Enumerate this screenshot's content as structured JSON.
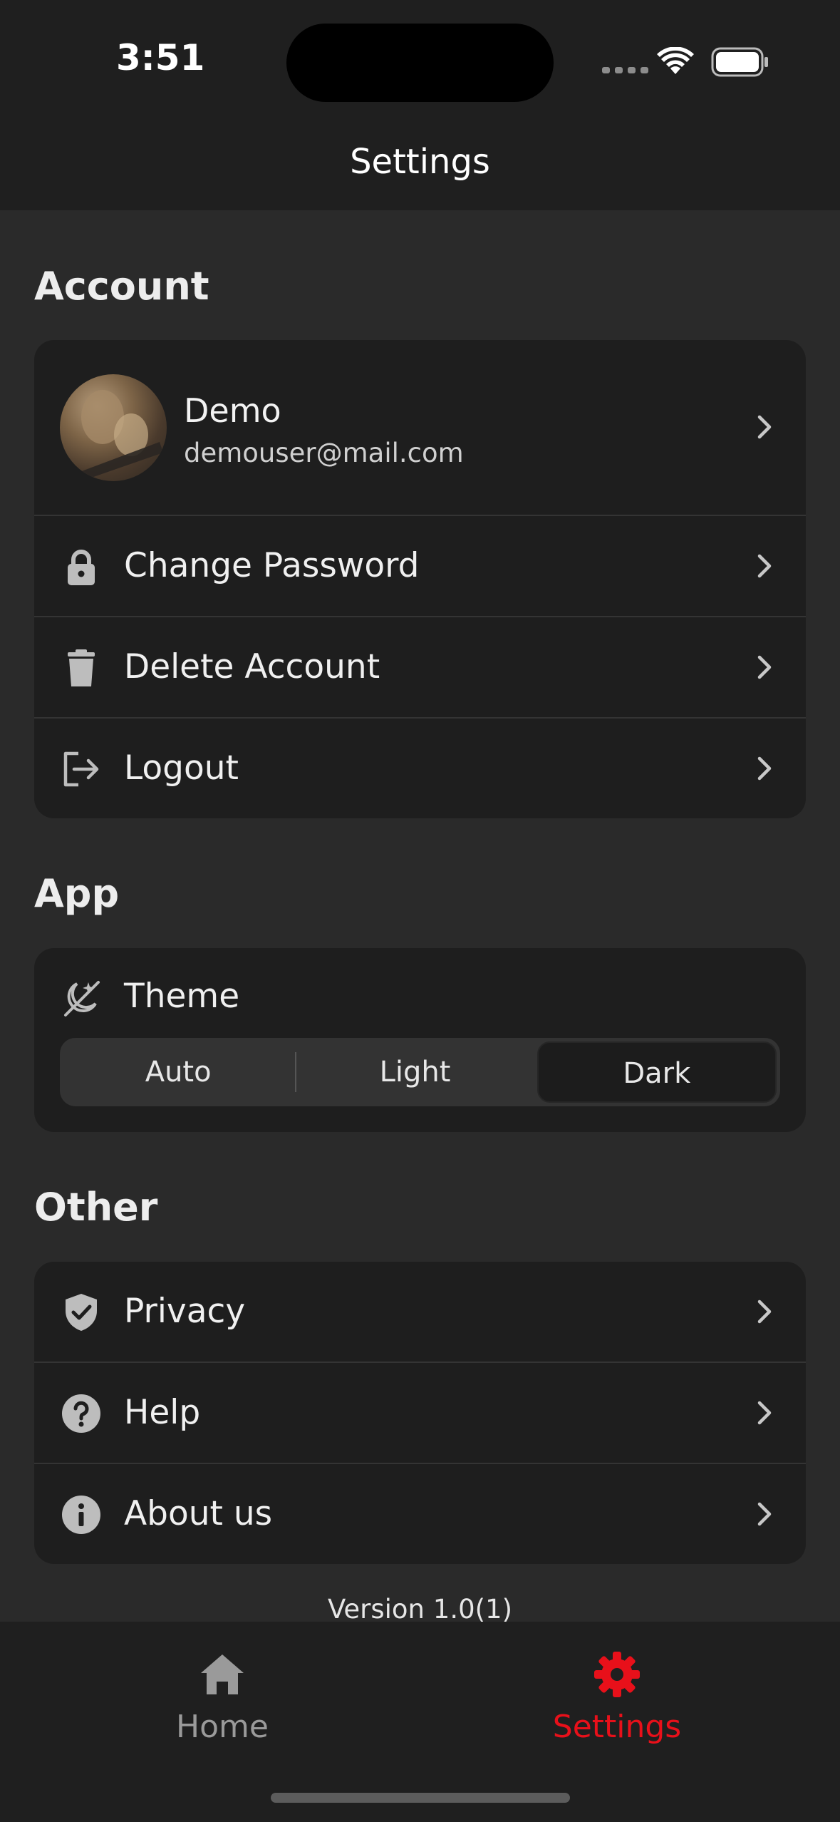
{
  "status_bar": {
    "time": "3:51"
  },
  "nav": {
    "title": "Settings"
  },
  "sections": {
    "account": "Account",
    "app": "App",
    "other": "Other"
  },
  "profile": {
    "name": "Demo",
    "email": "demouser@mail.com"
  },
  "account_items": [
    {
      "label": "Change Password",
      "icon": "lock-icon"
    },
    {
      "label": "Delete Account",
      "icon": "trash-icon"
    },
    {
      "label": "Logout",
      "icon": "logout-icon"
    }
  ],
  "theme": {
    "label": "Theme",
    "options": [
      "Auto",
      "Light",
      "Dark"
    ],
    "selected": "Dark"
  },
  "other_items": [
    {
      "label": "Privacy",
      "icon": "shield-check-icon"
    },
    {
      "label": "Help",
      "icon": "help-icon"
    },
    {
      "label": "About us",
      "icon": "info-icon"
    }
  ],
  "version": "Version 1.0(1)",
  "tabs": [
    {
      "label": "Home",
      "icon": "home-icon",
      "active": false
    },
    {
      "label": "Settings",
      "icon": "gear-icon",
      "active": true
    }
  ],
  "colors": {
    "accent": "#e8101a",
    "inactive_tab": "#9a9a9a",
    "background": "#2a2a2a",
    "card": "#1e1e1e"
  }
}
